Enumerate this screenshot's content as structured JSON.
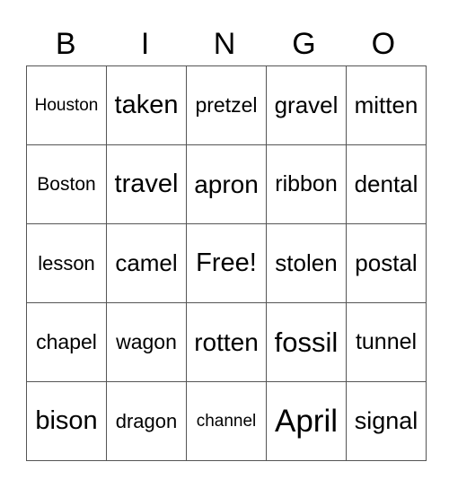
{
  "header": [
    "B",
    "I",
    "N",
    "G",
    "O"
  ],
  "rows": [
    [
      {
        "t": "Houston",
        "s": 19
      },
      {
        "t": "taken",
        "s": 29
      },
      {
        "t": "pretzel",
        "s": 23
      },
      {
        "t": "gravel",
        "s": 26
      },
      {
        "t": "mitten",
        "s": 26
      }
    ],
    [
      {
        "t": "Boston",
        "s": 21
      },
      {
        "t": "travel",
        "s": 29
      },
      {
        "t": "apron",
        "s": 28
      },
      {
        "t": "ribbon",
        "s": 25
      },
      {
        "t": "dental",
        "s": 26
      }
    ],
    [
      {
        "t": "lesson",
        "s": 22
      },
      {
        "t": "camel",
        "s": 26
      },
      {
        "t": "Free!",
        "s": 29
      },
      {
        "t": "stolen",
        "s": 26
      },
      {
        "t": "postal",
        "s": 26
      }
    ],
    [
      {
        "t": "chapel",
        "s": 23
      },
      {
        "t": "wagon",
        "s": 23
      },
      {
        "t": "rotten",
        "s": 28
      },
      {
        "t": "fossil",
        "s": 31
      },
      {
        "t": "tunnel",
        "s": 25
      }
    ],
    [
      {
        "t": "bison",
        "s": 29
      },
      {
        "t": "dragon",
        "s": 22
      },
      {
        "t": "channel",
        "s": 19
      },
      {
        "t": "April",
        "s": 35
      },
      {
        "t": "signal",
        "s": 27
      }
    ]
  ]
}
